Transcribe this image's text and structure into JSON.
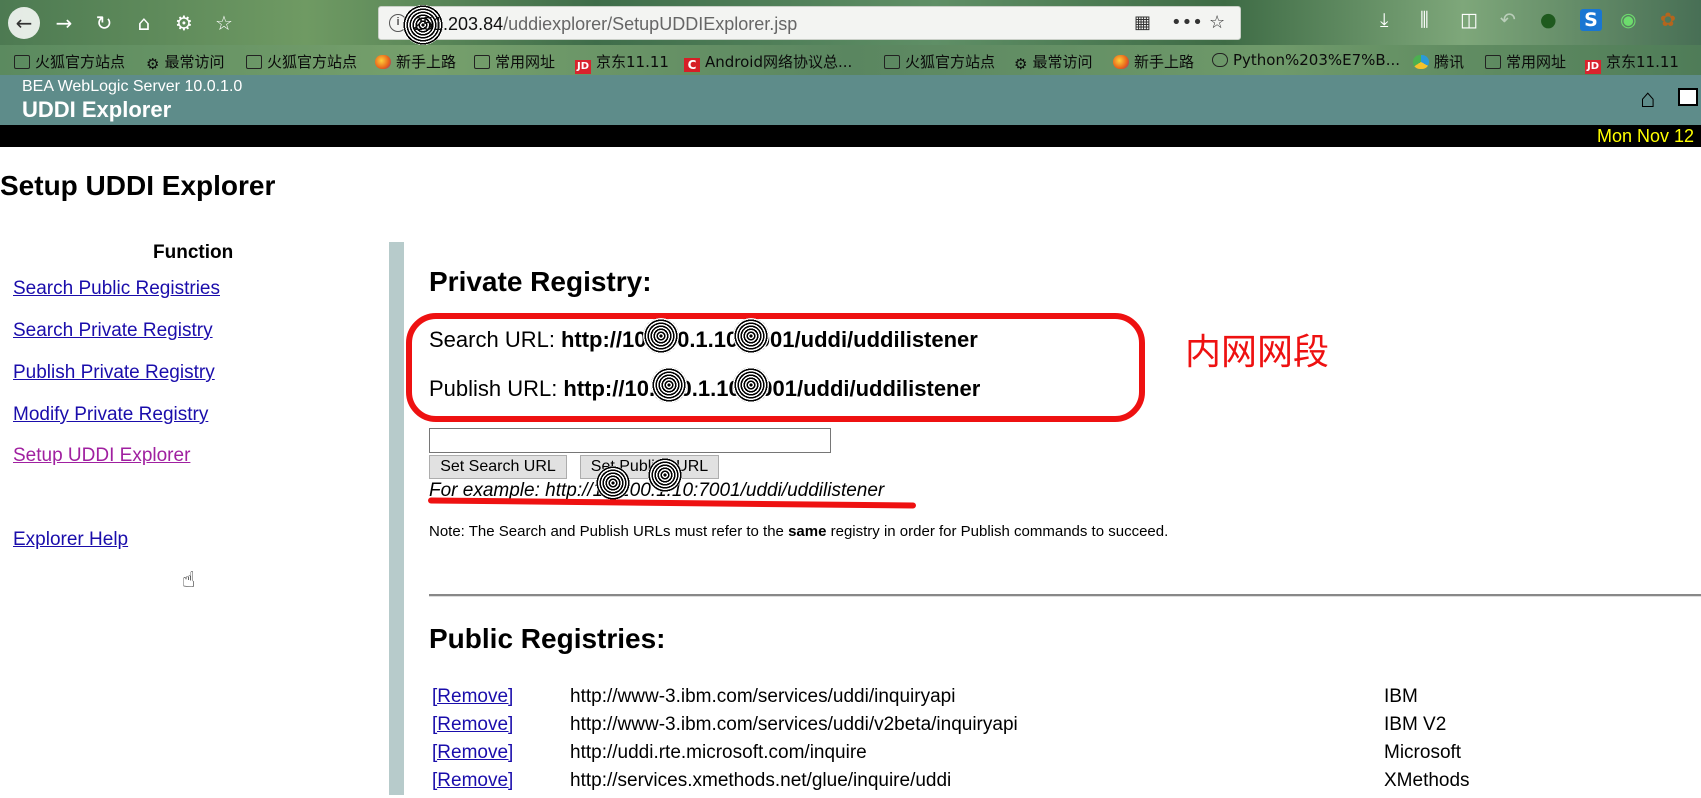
{
  "browser": {
    "url_host": "251.203.84",
    "url_path": "/uddiexplorer/SetupUDDIExplorer.jsp",
    "bookmarks": [
      {
        "label": "火狐官方站点",
        "icon": "folder-icon"
      },
      {
        "label": "最常访问",
        "icon": "gear-icon"
      },
      {
        "label": "火狐官方站点",
        "icon": "folder-icon"
      },
      {
        "label": "新手上路",
        "icon": "firefox-icon"
      },
      {
        "label": "常用网址",
        "icon": "folder-icon"
      },
      {
        "label": "京东11.11",
        "icon": "jd-icon"
      },
      {
        "label": "Android网络协议总...",
        "icon": "c-icon"
      },
      {
        "label": "火狐官方站点",
        "icon": "folder-icon"
      },
      {
        "label": "最常访问",
        "icon": "gear-icon"
      },
      {
        "label": "新手上路",
        "icon": "firefox-icon"
      },
      {
        "label": "Python%203%E7%B...",
        "icon": "globe-icon"
      },
      {
        "label": "腾讯",
        "icon": "qq-icon"
      },
      {
        "label": "常用网址",
        "icon": "folder-icon"
      },
      {
        "label": "京东11.11",
        "icon": "jd-icon"
      }
    ]
  },
  "header": {
    "product": "BEA WebLogic Server 10.0.1.0",
    "title": "UDDI Explorer",
    "date": "Mon Nov 12"
  },
  "page": {
    "title": "Setup UDDI Explorer"
  },
  "sidebar": {
    "heading": "Function",
    "links": [
      "Search Public Registries",
      "Search Private Registry",
      "Publish Private Registry",
      "Modify Private Registry",
      "Setup UDDI Explorer"
    ],
    "help": "Explorer Help"
  },
  "private": {
    "heading": "Private Registry:",
    "search_label": "Search URL:",
    "search_url": "http://10.100.1.10:7001/uddi/uddilistener",
    "publish_label": "Publish URL:",
    "publish_url": "http://10.100.1.10:7001/uddi/uddilistener",
    "input_value": "",
    "set_search_btn": "Set Search URL",
    "set_publish_btn": "Set Publish URL",
    "example": "For example: http://10.100.1.10:7001/uddi/uddilistener",
    "note_before": "Note: The Search and Publish URLs must refer to the ",
    "note_bold": "same",
    "note_after": " registry in order for Publish commands to succeed.",
    "annotation": "内网网段",
    "annotation_color": "#ee1111"
  },
  "public": {
    "heading": "Public Registries:",
    "remove_label": "[Remove]",
    "rows": [
      {
        "url": "http://www-3.ibm.com/services/uddi/inquiryapi",
        "name": "IBM"
      },
      {
        "url": "http://www-3.ibm.com/services/uddi/v2beta/inquiryapi",
        "name": "IBM V2"
      },
      {
        "url": "http://uddi.rte.microsoft.com/inquire",
        "name": "Microsoft"
      },
      {
        "url": "http://services.xmethods.net/glue/inquire/uddi",
        "name": "XMethods"
      }
    ]
  }
}
